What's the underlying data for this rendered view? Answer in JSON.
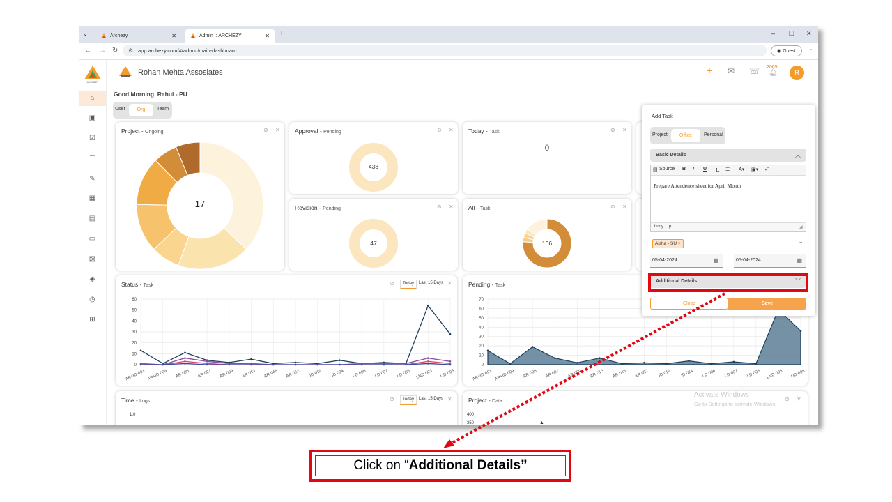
{
  "browser": {
    "tabs": [
      {
        "label": "Archezy",
        "close": "✕"
      },
      {
        "label": "Admin :: ARCHEZY",
        "close": "✕"
      }
    ],
    "new_tab": "+",
    "url": "app.archezy.com/#/admin/main-dashboard",
    "profile": "Guest",
    "window_controls": [
      "–",
      "❐",
      "✕"
    ]
  },
  "app": {
    "logo_text": "ARCHEZY",
    "org_name": "Rohan Mehta Assosiates",
    "notification_count": "2065",
    "avatar_initial": "R",
    "greeting": "Good Morning, Rahul - PU",
    "scope_tabs": [
      "User",
      "Org",
      "Team"
    ],
    "scope_selected": "Org",
    "sidebar_icons": [
      "home-icon",
      "badge-icon",
      "clipboard-check-icon",
      "list-icon",
      "edit-icon",
      "calendar-icon",
      "book-icon",
      "box-icon",
      "folder-image-icon",
      "shield-icon",
      "clipboard-clock-icon",
      "network-icon"
    ]
  },
  "cards": {
    "project": {
      "title": "Project",
      "subtitle": "Ongoing",
      "center": "17"
    },
    "approval": {
      "title": "Approval",
      "subtitle": "Pending",
      "center": "438"
    },
    "today": {
      "title": "Today",
      "subtitle": "Task",
      "center": "0"
    },
    "revision": {
      "title": "Revision",
      "subtitle": "Pending",
      "center": "47"
    },
    "all": {
      "title": "All",
      "subtitle": "Task",
      "center": "166"
    },
    "status": {
      "title": "Status",
      "subtitle": "Task",
      "btn_today": "Today",
      "btn_15": "Last 15 Days"
    },
    "pending": {
      "title": "Pending",
      "subtitle": "Task"
    },
    "time": {
      "title": "Time",
      "subtitle": "Logs",
      "btn_today": "Today",
      "btn_15": "Last 15 Days",
      "ytick": "1.0"
    },
    "projectdata": {
      "title": "Project",
      "subtitle": "Data",
      "yticks": [
        "400",
        "350"
      ]
    }
  },
  "chart_data": [
    {
      "type": "pie",
      "title": "Project - Ongoing",
      "values": [
        6,
        3,
        1.2,
        2,
        2,
        1,
        1
      ],
      "colors": [
        "#fdf2dc",
        "#fbe3ad",
        "#f9d590",
        "#f6c36c",
        "#f0ab45",
        "#d38c38",
        "#b06a2b"
      ]
    },
    {
      "type": "pie",
      "title": "Approval - Pending",
      "values": [
        438
      ],
      "labels": [
        "438"
      ],
      "colors": [
        "#fbe6bf",
        "#f6cd86"
      ]
    },
    {
      "type": "pie",
      "title": "Revision - Pending",
      "values": [
        47
      ],
      "labels": [
        "47"
      ],
      "colors": [
        "#fbe6bf"
      ]
    },
    {
      "type": "pie",
      "title": "All - Task",
      "values": [
        166
      ],
      "labels": [
        "166"
      ],
      "colors": [
        "#d38c38",
        "#f6cd86",
        "#fbe6bf"
      ]
    },
    {
      "type": "line",
      "title": "Status - Task",
      "categories": [
        "AR+ID-001",
        "AR+ID-009",
        "AR-005",
        "AR-007",
        "AR-009",
        "AR-013",
        "AR-048",
        "AR-052",
        "ID-019",
        "ID-024",
        "LD-006",
        "LD-007",
        "LD-008",
        "LND-003",
        "UD-005"
      ],
      "ylim": [
        0,
        60
      ],
      "yticks": [
        0,
        10,
        20,
        30,
        40,
        50,
        60
      ],
      "series": [
        {
          "color": "#1d3f5e",
          "values": [
            13,
            1,
            11,
            4,
            2,
            5,
            1,
            2,
            1,
            4,
            1,
            2,
            1,
            54,
            28
          ]
        },
        {
          "color": "#8e4a9e",
          "values": [
            1,
            0,
            6,
            3,
            1,
            1,
            0,
            0,
            0,
            0,
            1,
            1,
            1,
            6,
            3
          ]
        },
        {
          "color": "#d94a7a",
          "values": [
            0,
            0,
            3,
            1,
            0,
            0,
            0,
            0,
            0,
            0,
            0,
            0,
            0,
            3,
            1
          ]
        },
        {
          "color": "#3a4fa0",
          "values": [
            0,
            0,
            1,
            0,
            0,
            0,
            0,
            0,
            0,
            0,
            0,
            0,
            0,
            1,
            0
          ]
        }
      ]
    },
    {
      "type": "area",
      "title": "Pending - Task",
      "categories": [
        "AR+ID-001",
        "AR+ID-009",
        "AR-005",
        "AR-007",
        "AR-009",
        "AR-013",
        "AR-048",
        "AR-052",
        "ID-019",
        "ID-024",
        "LD-006",
        "LD-007",
        "LD-008",
        "LND-003",
        "UD-005"
      ],
      "ylim": [
        0,
        70
      ],
      "yticks": [
        0,
        10,
        20,
        30,
        40,
        50,
        60,
        70
      ],
      "series": [
        {
          "color": "#1d3f5e",
          "values": [
            15,
            1,
            19,
            7,
            2,
            7,
            1,
            2,
            1,
            4,
            1,
            3,
            1,
            59,
            36
          ]
        }
      ]
    }
  ],
  "add_task": {
    "title": "Add Task",
    "type_tabs": [
      "Project",
      "Office",
      "Personal"
    ],
    "type_selected": "Office",
    "basic_details": "Basic Details",
    "toolbar": {
      "source": "Source",
      "bold": "B",
      "italic": "I",
      "underline": "U"
    },
    "description": "Prepare Attendence sheet for April Month",
    "path_body": "body",
    "path_p": "p",
    "assignee": "Aisha - SU",
    "start_date": "05-04-2024",
    "end_date": "05-04-2024",
    "additional_details": "Additional Details",
    "close_label": "Close",
    "save_label": "Save"
  },
  "watermark": {
    "line1": "Activate Windows",
    "line2": "Go to Settings to activate Windows."
  },
  "callout": {
    "prefix": "Click on “",
    "bold": "Additional Details",
    "suffix": "”"
  },
  "accent_color": "#f39c2b",
  "highlight_color": "#e30613"
}
